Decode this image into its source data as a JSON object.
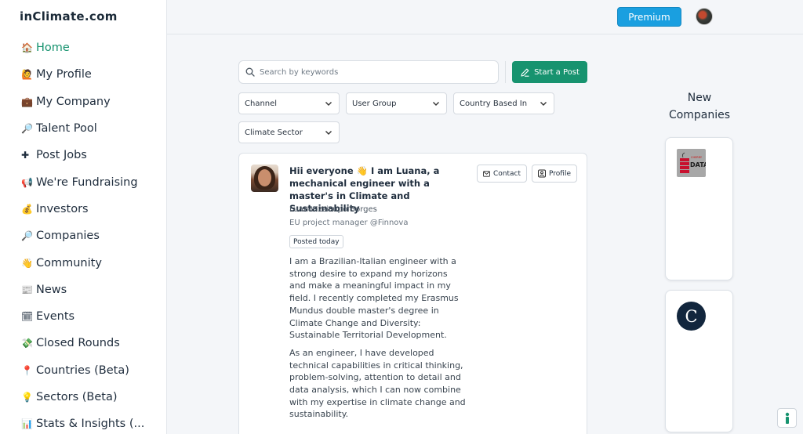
{
  "app": {
    "logo_text": "inClimate.com"
  },
  "sidebar": {
    "items": [
      {
        "emoji": "🏠",
        "label": "Home",
        "active": true
      },
      {
        "emoji": "🙋",
        "label": "My Profile"
      },
      {
        "emoji": "💼",
        "label": "My Company"
      },
      {
        "emoji": "🔎",
        "label": "Talent Pool"
      },
      {
        "emoji": "✚",
        "label": "Post Jobs"
      },
      {
        "emoji": "📢",
        "label": "We're Fundraising"
      },
      {
        "emoji": "💰",
        "label": "Investors"
      },
      {
        "emoji": "🔎",
        "label": "Companies"
      },
      {
        "emoji": "👋",
        "label": "Community"
      },
      {
        "emoji": "📰",
        "label": "News"
      },
      {
        "emoji": "🗓",
        "label": "Events"
      },
      {
        "emoji": "💸",
        "label": "Closed Rounds"
      },
      {
        "emoji": "📍",
        "label": "Countries (Beta)"
      },
      {
        "emoji": "💡",
        "label": "Sectors (Beta)"
      },
      {
        "emoji": "📊",
        "label": "Stats & Insights (..."
      }
    ]
  },
  "header": {
    "premium_label": "Premium"
  },
  "search": {
    "placeholder": "Search by keywords"
  },
  "actions": {
    "start_post_label": "Start a Post"
  },
  "filters": {
    "channel": "Channel",
    "user_group": "User Group",
    "country": "Country Based In",
    "sector": "Climate Sector"
  },
  "post": {
    "title": "Hii everyone 👋 I am Luana, a mechanical engineer with a master's in Climate and Sustainability",
    "author": "Luana Izzicupo Borges",
    "role": "EU project manager @Finnova",
    "badge": "Posted today",
    "contact_label": "Contact",
    "profile_label": "Profile",
    "body_p1": "I am a Brazilian-Italian engineer with a strong desire to expand my horizons and make a meaningful impact in my field. I recently completed my Erasmus Mundus double master's degree in Climate Change and Diversity: Sustainable Territorial Development.",
    "body_p2": "As an engineer, I have developed technical capabilities in critical thinking, problem-solving, attention to detail and data analysis, which I can now combine with my expertise in climate change and sustainability."
  },
  "new_companies": {
    "heading": "New Companies",
    "companies": [
      {
        "logo_text": "DATA",
        "logo_small_text": "CHERRY"
      },
      {
        "logo_text": "C"
      }
    ]
  },
  "colors": {
    "brand_green": "#17936f",
    "premium_blue": "#1a9fe0"
  }
}
